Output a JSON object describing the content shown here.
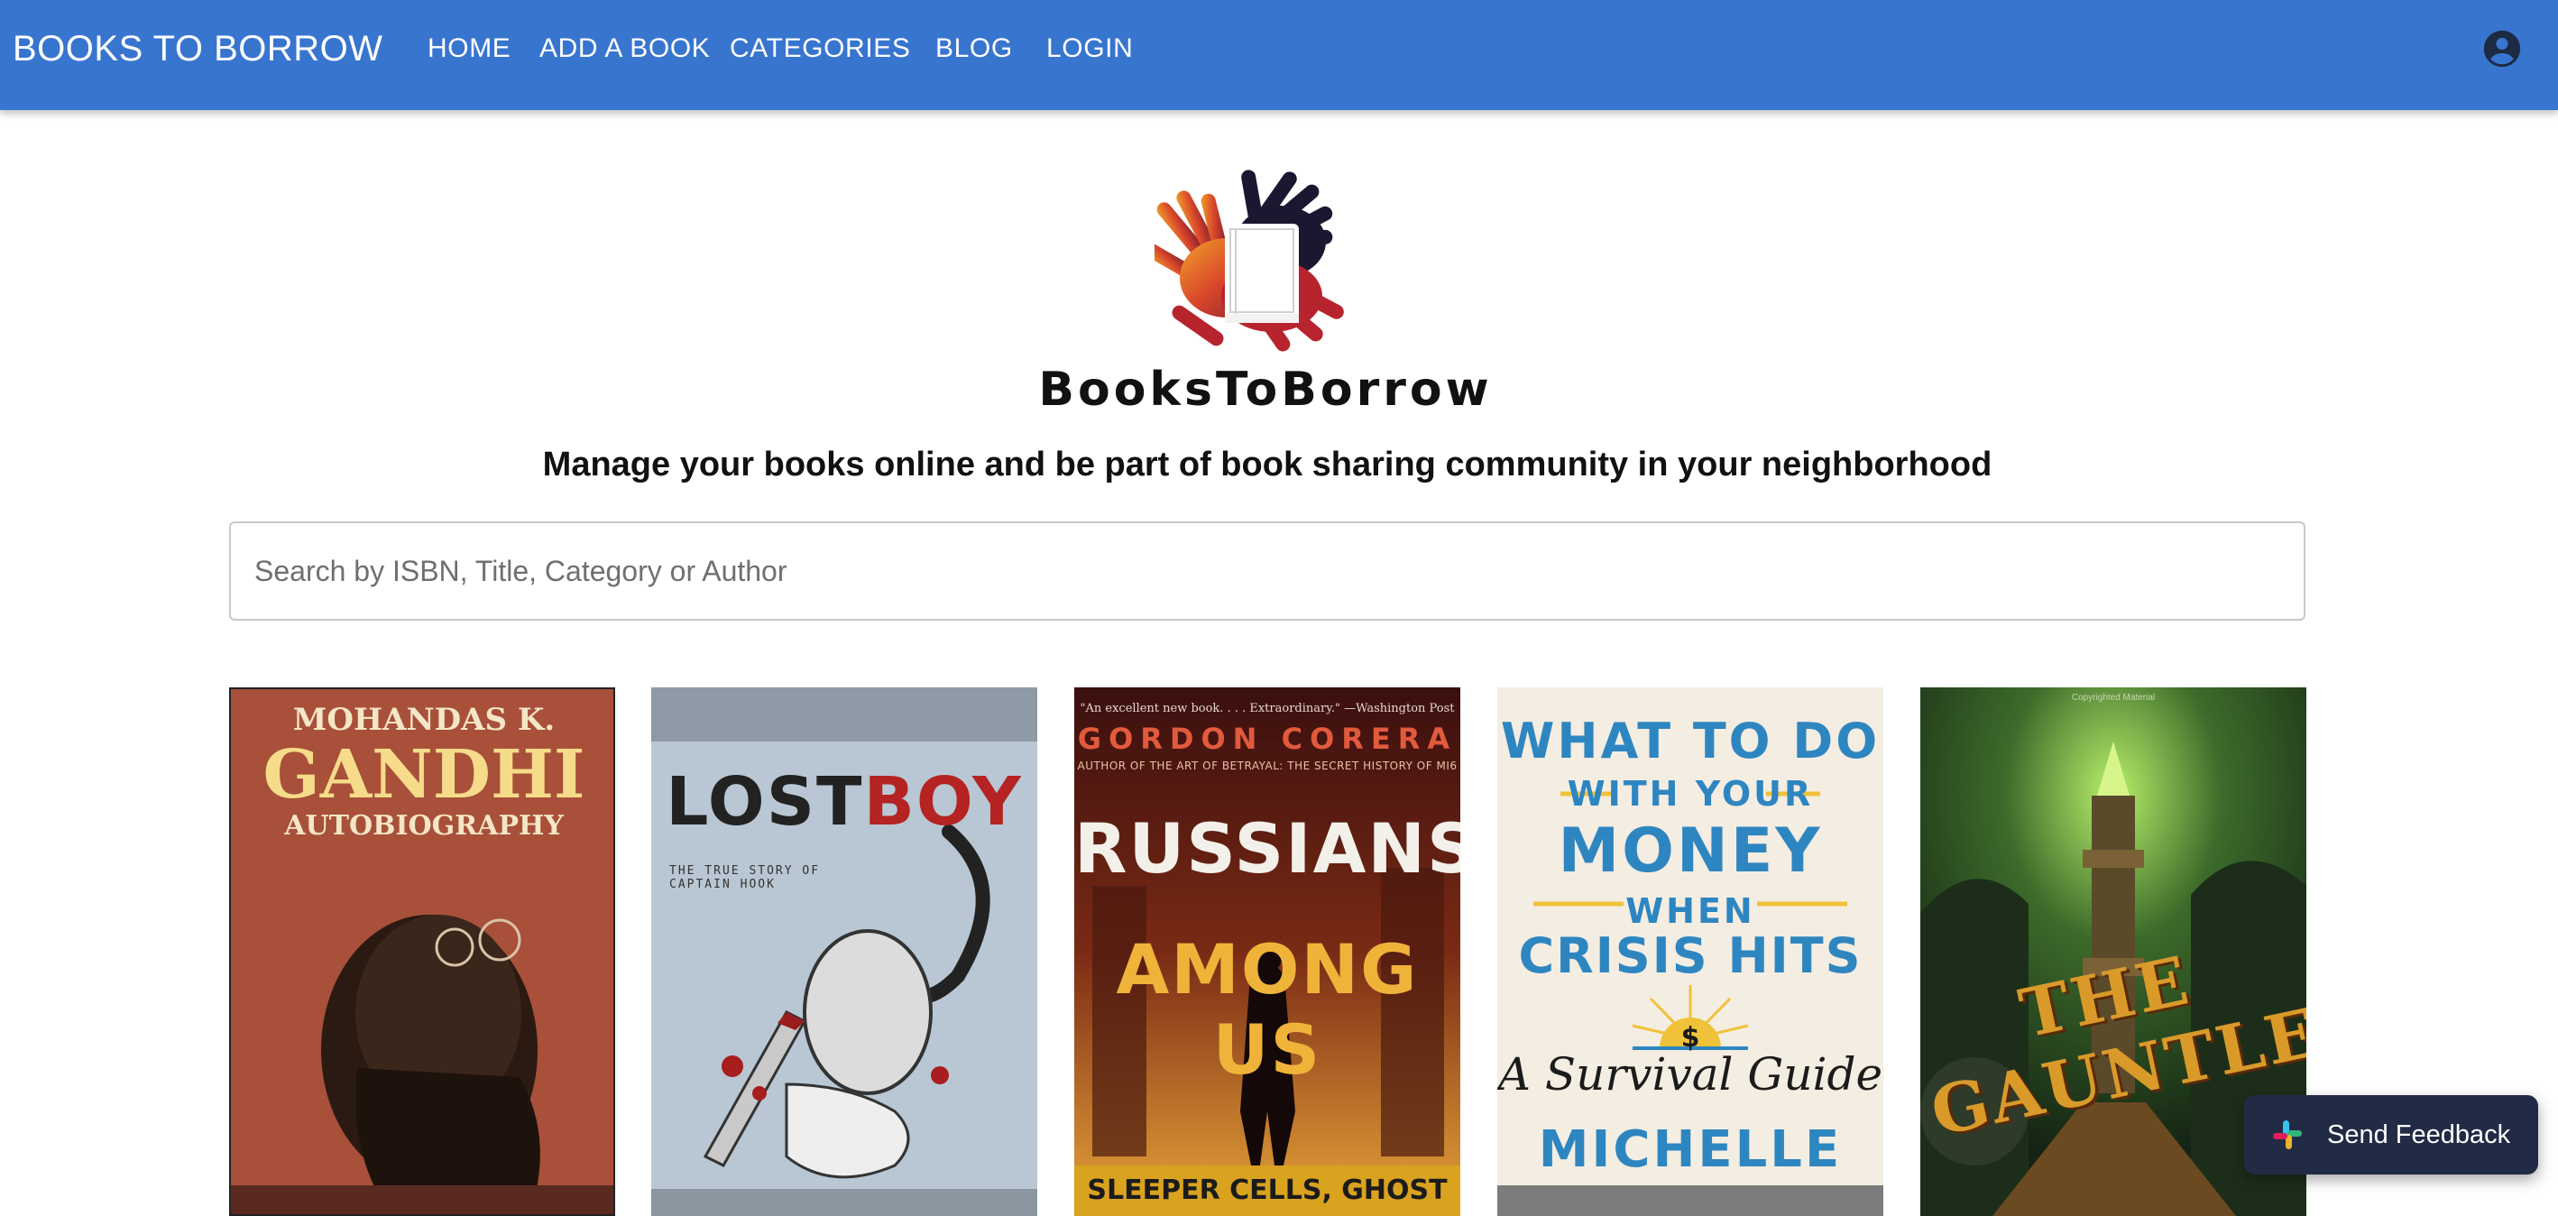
{
  "header": {
    "brand": "BOOKS TO BORROW",
    "nav": {
      "home": "HOME",
      "add_book": "ADD A BOOK",
      "categories": "CATEGORIES",
      "blog": "BLOG",
      "login": "LOGIN"
    },
    "account_icon": "account-circle-icon",
    "background_color": "#3875cf"
  },
  "hero": {
    "logo_text": "BooksToBorrow",
    "tagline": "Manage your books online and be part of book sharing community in your neighborhood"
  },
  "search": {
    "placeholder": "Search by ISBN, Title, Category or Author",
    "value": ""
  },
  "books": [
    {
      "cover_lines": [
        "MOHANDAS K.",
        "GANDHI",
        "AUTOBIOGRAPHY"
      ]
    },
    {
      "cover_lines": [
        "LOST",
        "BOY",
        "THE TRUE STORY OF CAPTAIN HOOK"
      ]
    },
    {
      "cover_lines": [
        "\"An excellent new book. . . . Extraordinary.\" —Washington Post",
        "GORDON CORERA",
        "AUTHOR OF THE ART OF BETRAYAL: THE SECRET HISTORY OF MI6",
        "RUSSIANS",
        "AMONG US",
        "SLEEPER CELLS, GHOST STORIES,"
      ]
    },
    {
      "cover_lines": [
        "WHAT TO DO",
        "WITH YOUR",
        "MONEY",
        "WHEN",
        "CRISIS HITS",
        "A Survival Guide",
        "MICHELLE"
      ]
    },
    {
      "cover_lines": [
        "Copyrighted Material",
        "THE GAUNTLET"
      ]
    }
  ],
  "feedback": {
    "label": "Send Feedback",
    "icon": "slack-icon",
    "background_color": "#222b45"
  }
}
